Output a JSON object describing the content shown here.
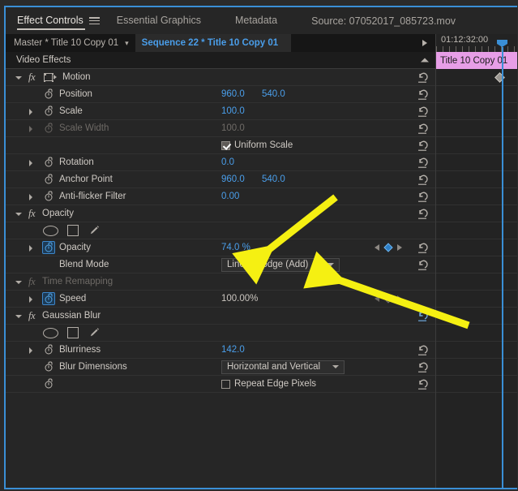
{
  "panel": {
    "tabs": [
      {
        "label": "Effect Controls",
        "active": true,
        "menu_icon": "hamburger-menu-icon"
      },
      {
        "label": "Essential Graphics",
        "active": false
      },
      {
        "label": "Metadata",
        "active": false
      }
    ],
    "source_label": "Source: 07052017_085723.mov"
  },
  "clip_bar": {
    "master": "Master * Title 10 Copy 01",
    "caret_icon": "chevron-down-icon",
    "sequence": "Sequence 22 * Title 10 Copy 01",
    "arrow_icon": "play-arrow-icon"
  },
  "video_effects_header": {
    "label": "Video Effects",
    "collapse_icon": "chevron-up-icon"
  },
  "effects": [
    {
      "type": "fx",
      "name": "Motion",
      "expanded": true,
      "disabled": false,
      "fx_badge": "fx",
      "has_transform_icon": true,
      "reset_icon": "reset-icon"
    },
    {
      "type": "prop",
      "name": "Position",
      "values": [
        "960.0",
        "540.0"
      ],
      "stopwatch": "stopwatch-icon",
      "has_disclose": false,
      "reset_icon": "reset-icon"
    },
    {
      "type": "prop",
      "name": "Scale",
      "values": [
        "100.0"
      ],
      "stopwatch": "stopwatch-icon",
      "has_disclose": true,
      "reset_icon": "reset-icon"
    },
    {
      "type": "prop",
      "name": "Scale Width",
      "values": [
        "100.0"
      ],
      "stopwatch": "stopwatch-icon",
      "has_disclose": true,
      "disabled": true,
      "reset_icon": "reset-icon"
    },
    {
      "type": "checkbox",
      "name": "Uniform Scale",
      "checked": true,
      "reset_icon": "reset-icon"
    },
    {
      "type": "prop",
      "name": "Rotation",
      "values": [
        "0.0"
      ],
      "stopwatch": "stopwatch-icon",
      "has_disclose": true,
      "reset_icon": "reset-icon"
    },
    {
      "type": "prop",
      "name": "Anchor Point",
      "values": [
        "960.0",
        "540.0"
      ],
      "stopwatch": "stopwatch-icon",
      "has_disclose": false,
      "reset_icon": "reset-icon"
    },
    {
      "type": "prop",
      "name": "Anti-flicker Filter",
      "values": [
        "0.00"
      ],
      "stopwatch": "stopwatch-icon",
      "has_disclose": true,
      "reset_icon": "reset-icon"
    },
    {
      "type": "fx",
      "name": "Opacity",
      "expanded": true,
      "disabled": false,
      "fx_badge": "fx",
      "reset_icon": "reset-icon"
    },
    {
      "type": "masktools",
      "tools": [
        "ellipse-mask-icon",
        "rectangle-mask-icon",
        "pen-mask-icon"
      ]
    },
    {
      "type": "prop",
      "name": "Opacity",
      "values": [
        "74.0 %"
      ],
      "stopwatch": "stopwatch-icon",
      "stopwatch_active": true,
      "has_disclose": true,
      "keyframe_nav": true,
      "keyframe_at_playhead": true,
      "reset_icon": "reset-icon"
    },
    {
      "type": "dropdown",
      "name": "Blend Mode",
      "value": "Linear Dodge (Add)",
      "caret_icon": "chevron-down-icon",
      "reset_icon": "reset-icon"
    },
    {
      "type": "fx",
      "name": "Time Remapping",
      "expanded": true,
      "disabled": true,
      "fx_badge": "fx"
    },
    {
      "type": "prop",
      "name": "Speed",
      "values": [
        "100.00%"
      ],
      "value_plain": true,
      "stopwatch": "stopwatch-icon",
      "stopwatch_active": true,
      "has_disclose": true,
      "keyframe_nav": true,
      "keyframe_at_playhead": false
    },
    {
      "type": "fx",
      "name": "Gaussian Blur",
      "expanded": true,
      "disabled": false,
      "fx_badge": "fx",
      "reset_icon": "reset-icon"
    },
    {
      "type": "masktools",
      "tools": [
        "ellipse-mask-icon",
        "rectangle-mask-icon",
        "pen-mask-icon"
      ]
    },
    {
      "type": "prop",
      "name": "Blurriness",
      "values": [
        "142.0"
      ],
      "stopwatch": "stopwatch-icon",
      "has_disclose": true,
      "reset_icon": "reset-icon"
    },
    {
      "type": "dropdown",
      "name": "Blur Dimensions",
      "value": "Horizontal and Vertical",
      "caret_icon": "chevron-down-icon",
      "stopwatch": "stopwatch-icon",
      "reset_icon": "reset-icon"
    },
    {
      "type": "checkbox",
      "name": "Repeat Edge Pixels",
      "checked": false,
      "stopwatch": "stopwatch-icon",
      "reset_icon": "reset-icon"
    }
  ],
  "timeline": {
    "timecode": "01:12:32:00",
    "clip_name": "Title 10 Copy 01",
    "playhead_icon": "playhead-icon",
    "keyframe_icon": "keyframe-diamond-icon"
  },
  "annotations": [
    {
      "name": "opacity-value-arrow",
      "color": "#f5f012"
    },
    {
      "name": "blend-mode-arrow",
      "color": "#f5f012"
    }
  ],
  "colors": {
    "accent_blue": "#4a9eea",
    "panel_bg": "#262626",
    "clip_pink": "#e79ee7",
    "annotation_yellow": "#f5f012"
  }
}
